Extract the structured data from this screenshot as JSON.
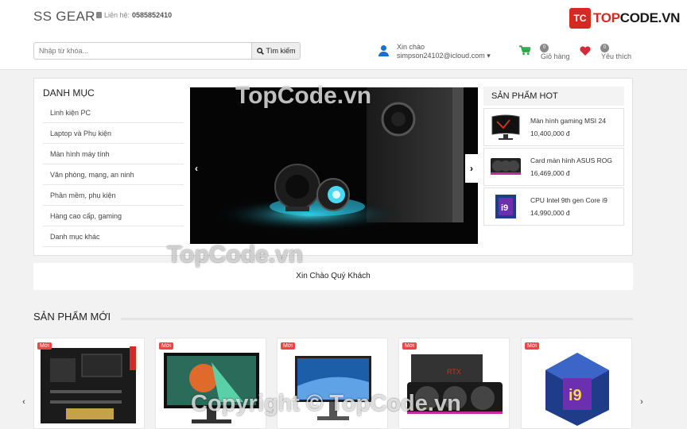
{
  "header": {
    "brand": "SS GEAR",
    "contact_label": "Liên hệ:",
    "contact_phone": "0585852410",
    "logo_mark": "TC",
    "logo_text_prefix": "TOP",
    "logo_text_suffix": "CODE.VN",
    "search_placeholder": "Nhập từ khóa...",
    "search_button": "Tìm kiếm",
    "greeting": "Xin chào",
    "user_email": "simpson24102@icloud.com ▾",
    "cart_count": "0",
    "cart_label": "Giỏ hàng",
    "wishlist_count": "0",
    "wishlist_label": "Yêu thích",
    "colors": {
      "accent_red": "#d62a20",
      "cart_green": "#2ea54a",
      "user_blue": "#1a6fd4"
    }
  },
  "categories": {
    "title": "DANH MỤC",
    "items": [
      {
        "label": "Linh kiện PC"
      },
      {
        "label": "Laptop và Phụ kiện"
      },
      {
        "label": "Màn hình máy tính"
      },
      {
        "label": "Văn phòng, mạng, an ninh"
      },
      {
        "label": "Phần mềm, phụ kiện"
      },
      {
        "label": "Hàng cao cấp, gaming"
      },
      {
        "label": "Danh mục khác"
      }
    ]
  },
  "slider": {
    "prev": "‹",
    "next": "›"
  },
  "hot": {
    "title": "SẢN PHẨM HOT",
    "items": [
      {
        "name": "Màn hình gaming MSI 24",
        "price": "10,400,000 đ",
        "icon": "monitor-icon"
      },
      {
        "name": "Card màn hình ASUS ROG",
        "price": "16,469,000 đ",
        "icon": "gpu-icon"
      },
      {
        "name": "CPU Intel 9th gen Core i9",
        "price": "14,990,000 đ",
        "icon": "cpu-icon"
      }
    ]
  },
  "welcome": "Xin Chào Quý Khách",
  "new_products": {
    "title": "SẢN PHẨM MỚI",
    "tag": "Mới",
    "prev": "‹",
    "next": "›",
    "items": [
      {
        "icon": "motherboard-icon"
      },
      {
        "icon": "monitor-icon"
      },
      {
        "icon": "monitor-icon"
      },
      {
        "icon": "gpu-icon"
      },
      {
        "icon": "cpu-icon"
      }
    ]
  },
  "watermarks": {
    "top": "TopCode.vn",
    "middle": "TopCode.vn",
    "bottom": "Copyright © TopCode.vn"
  }
}
